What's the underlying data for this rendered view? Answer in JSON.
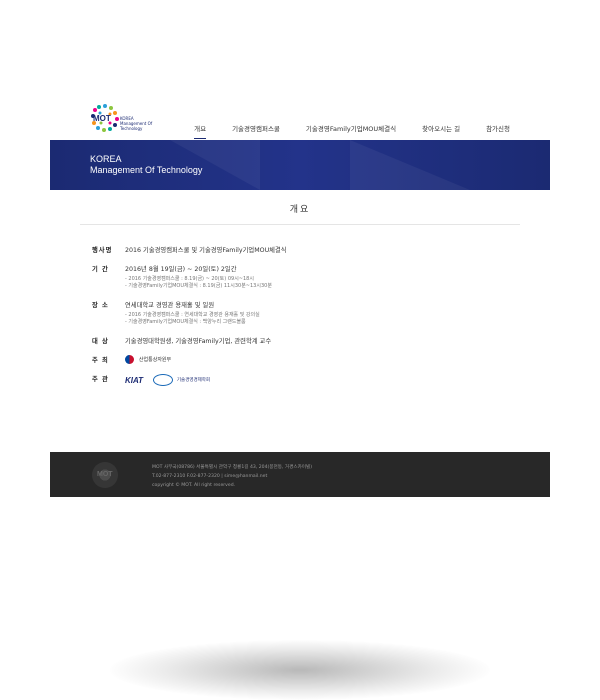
{
  "header": {
    "logo_mot": "MOT",
    "logo_tagline": "KOREA Management Of Technology",
    "nav": [
      {
        "label": "개요"
      },
      {
        "label": "기술경영캠퍼스쿨"
      },
      {
        "label": "기술경영Family기업MOU체결식"
      },
      {
        "label": "찾아오시는 길"
      },
      {
        "label": "참가신청"
      }
    ]
  },
  "banner": {
    "line1": "KOREA",
    "line2": "Management Of Technology"
  },
  "section_title": "개요",
  "details": {
    "event": {
      "label": "행사명",
      "value": "2016 기술경영캠퍼스쿨 및 기술경영Family기업MOU체결식"
    },
    "period": {
      "label": "기 간",
      "value": "2016년 8월 19일(금) ~ 20일(토) 2일간",
      "sub1": "- 2016 기술경영캠퍼스쿨 : 8.19(금) ~ 20(토) 09시~18시",
      "sub2": "- 기술경영Family기업MOU체결식 : 8.19(금) 11시30분~13시30분"
    },
    "venue": {
      "label": "장 소",
      "value": "연세대학교 경영관 용재홀 및 일원",
      "sub1": "- 2016 기술경영캠퍼스쿨 : 연세대학교 경영관 용재홀 및 강의실",
      "sub2": "- 기술경영Family기업MOU체결식 : 백양누리 그랜드볼룸"
    },
    "target": {
      "label": "대 상",
      "value": "기술경영대학원생, 기술경영Family기업, 관련학계 교수"
    },
    "host": {
      "label": "주 최",
      "org": "산업통상자원부"
    },
    "organizer": {
      "label": "주 관",
      "org1": "KIAT",
      "org2": "기술경영경제학회"
    }
  },
  "footer": {
    "logo": "MOT",
    "line1": "MOT 사무국(08786) 서울특별시 관악구 청룡1길 43, 204(봉천동, 거경스카이빌)",
    "line2": "T.02-877-2310 F.02-877-2320  |  sime@hanmail.net",
    "line3": "copyright © MOT. All right reserved."
  }
}
